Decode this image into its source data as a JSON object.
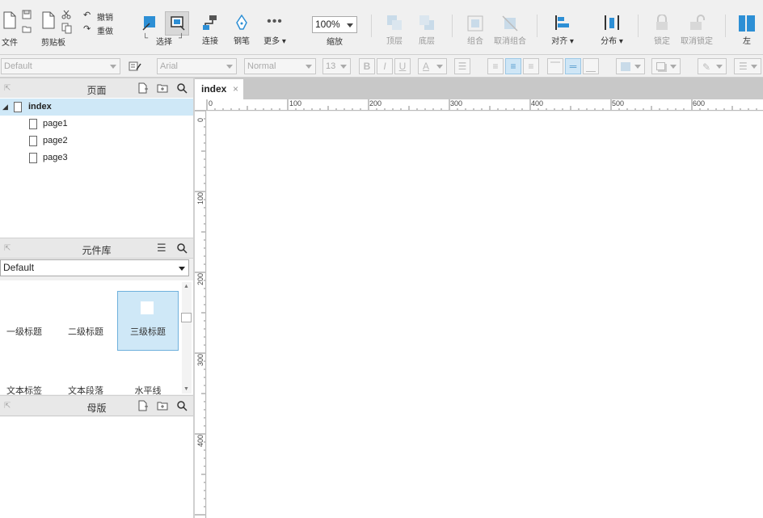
{
  "toolbar": {
    "file": "文件",
    "clipboard": "剪贴板",
    "undo": "撤销",
    "redo": "重做",
    "select": "选择",
    "connect": "连接",
    "pen": "钢笔",
    "more": "更多 ▾",
    "zoom_value": "100%",
    "zoom_label": "缩放",
    "top": "顶层",
    "bottom": "底层",
    "group": "组合",
    "ungroup": "取消组合",
    "align": "对齐 ▾",
    "distribute": "分布 ▾",
    "lock": "锁定",
    "unlock": "取消锁定",
    "left": "左"
  },
  "formatbar": {
    "style": "Default",
    "font": "Arial",
    "weight": "Normal",
    "size": "13",
    "bold": "B",
    "italic": "I",
    "underline": "U",
    "font_color": "A"
  },
  "pages_panel": {
    "title": "页面",
    "items": [
      {
        "label": "index",
        "selected": true,
        "level": 0
      },
      {
        "label": "page1",
        "level": 1
      },
      {
        "label": "page2",
        "level": 1
      },
      {
        "label": "page3",
        "level": 1
      }
    ]
  },
  "library_panel": {
    "title": "元件库",
    "selected_library": "Default",
    "widgets": [
      "一级标题",
      "二级标题",
      "三级标题",
      "文本标签",
      "文本段落",
      "水平线"
    ]
  },
  "masters_panel": {
    "title": "母版"
  },
  "tabs": [
    {
      "label": "index",
      "close": "×"
    }
  ],
  "rulers": {
    "h_labels": [
      "0",
      "100",
      "200",
      "300",
      "400",
      "500",
      "600"
    ],
    "v_labels": [
      "0",
      "100",
      "200",
      "300",
      "400"
    ]
  },
  "colors": {
    "accent_blue": "#2d8fd5",
    "selection_bg": "#cfe8f7",
    "toolbar_bg": "#f0f0f0"
  }
}
